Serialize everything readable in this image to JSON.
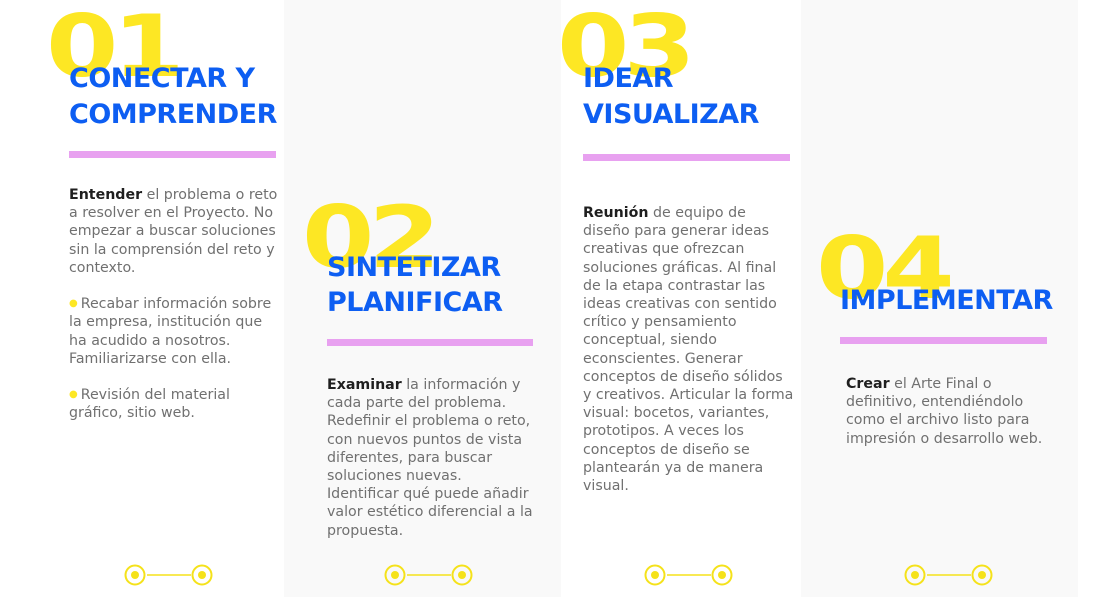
{
  "colors": {
    "number": "#fde724",
    "title": "#0d5ef2",
    "divider": "#e8a1f0",
    "body_text": "#707070",
    "lead_text": "#1f1f1f",
    "column_bg": "#f9f9f9",
    "bullet": "#fde724",
    "connector": "#f5e21a"
  },
  "steps": [
    {
      "number": "01",
      "title_line1": "CONECTAR Y",
      "title_line2": "COMPRENDER",
      "lead": "Entender",
      "text": " el problema o reto a resolver en el Proyecto. No empezar a buscar soluciones sin la comprensión del reto y contexto.",
      "bullets": [
        "Recabar información sobre la empresa, institución que ha acudido a nosotros. Familiarizarse con ella.",
        "Revisión del material gráfico, sitio web."
      ]
    },
    {
      "number": "02",
      "title_line1": "SINTETIZAR",
      "title_line2": "PLANIFICAR",
      "lead": "Examinar",
      "text": " la información y cada parte del problema. Redefinir el problema o reto, con nuevos puntos de vista diferentes, para buscar soluciones nuevas. Identificar qué puede añadir valor estético diferencial a la propuesta."
    },
    {
      "number": "03",
      "title_line1": "IDEAR",
      "title_line2": "VISUALIZAR",
      "lead": "Reunión",
      "text": " de equipo de diseño para generar ideas creativas que ofrezcan soluciones gráficas. Al final de la etapa contrastar las ideas creativas con sentido crítico y pensamiento conceptual, siendo econscientes. Generar conceptos de diseño sólidos y creativos. Articular la forma visual: bocetos, variantes, prototipos. A veces los conceptos de diseño se plantearán ya de manera visual."
    },
    {
      "number": "04",
      "title_line1": "IMPLEMENTAR",
      "lead": "Crear",
      "text": " el Arte Final o definitivo, entendiéndolo como el archivo listo para impresión o desarrollo web."
    }
  ]
}
